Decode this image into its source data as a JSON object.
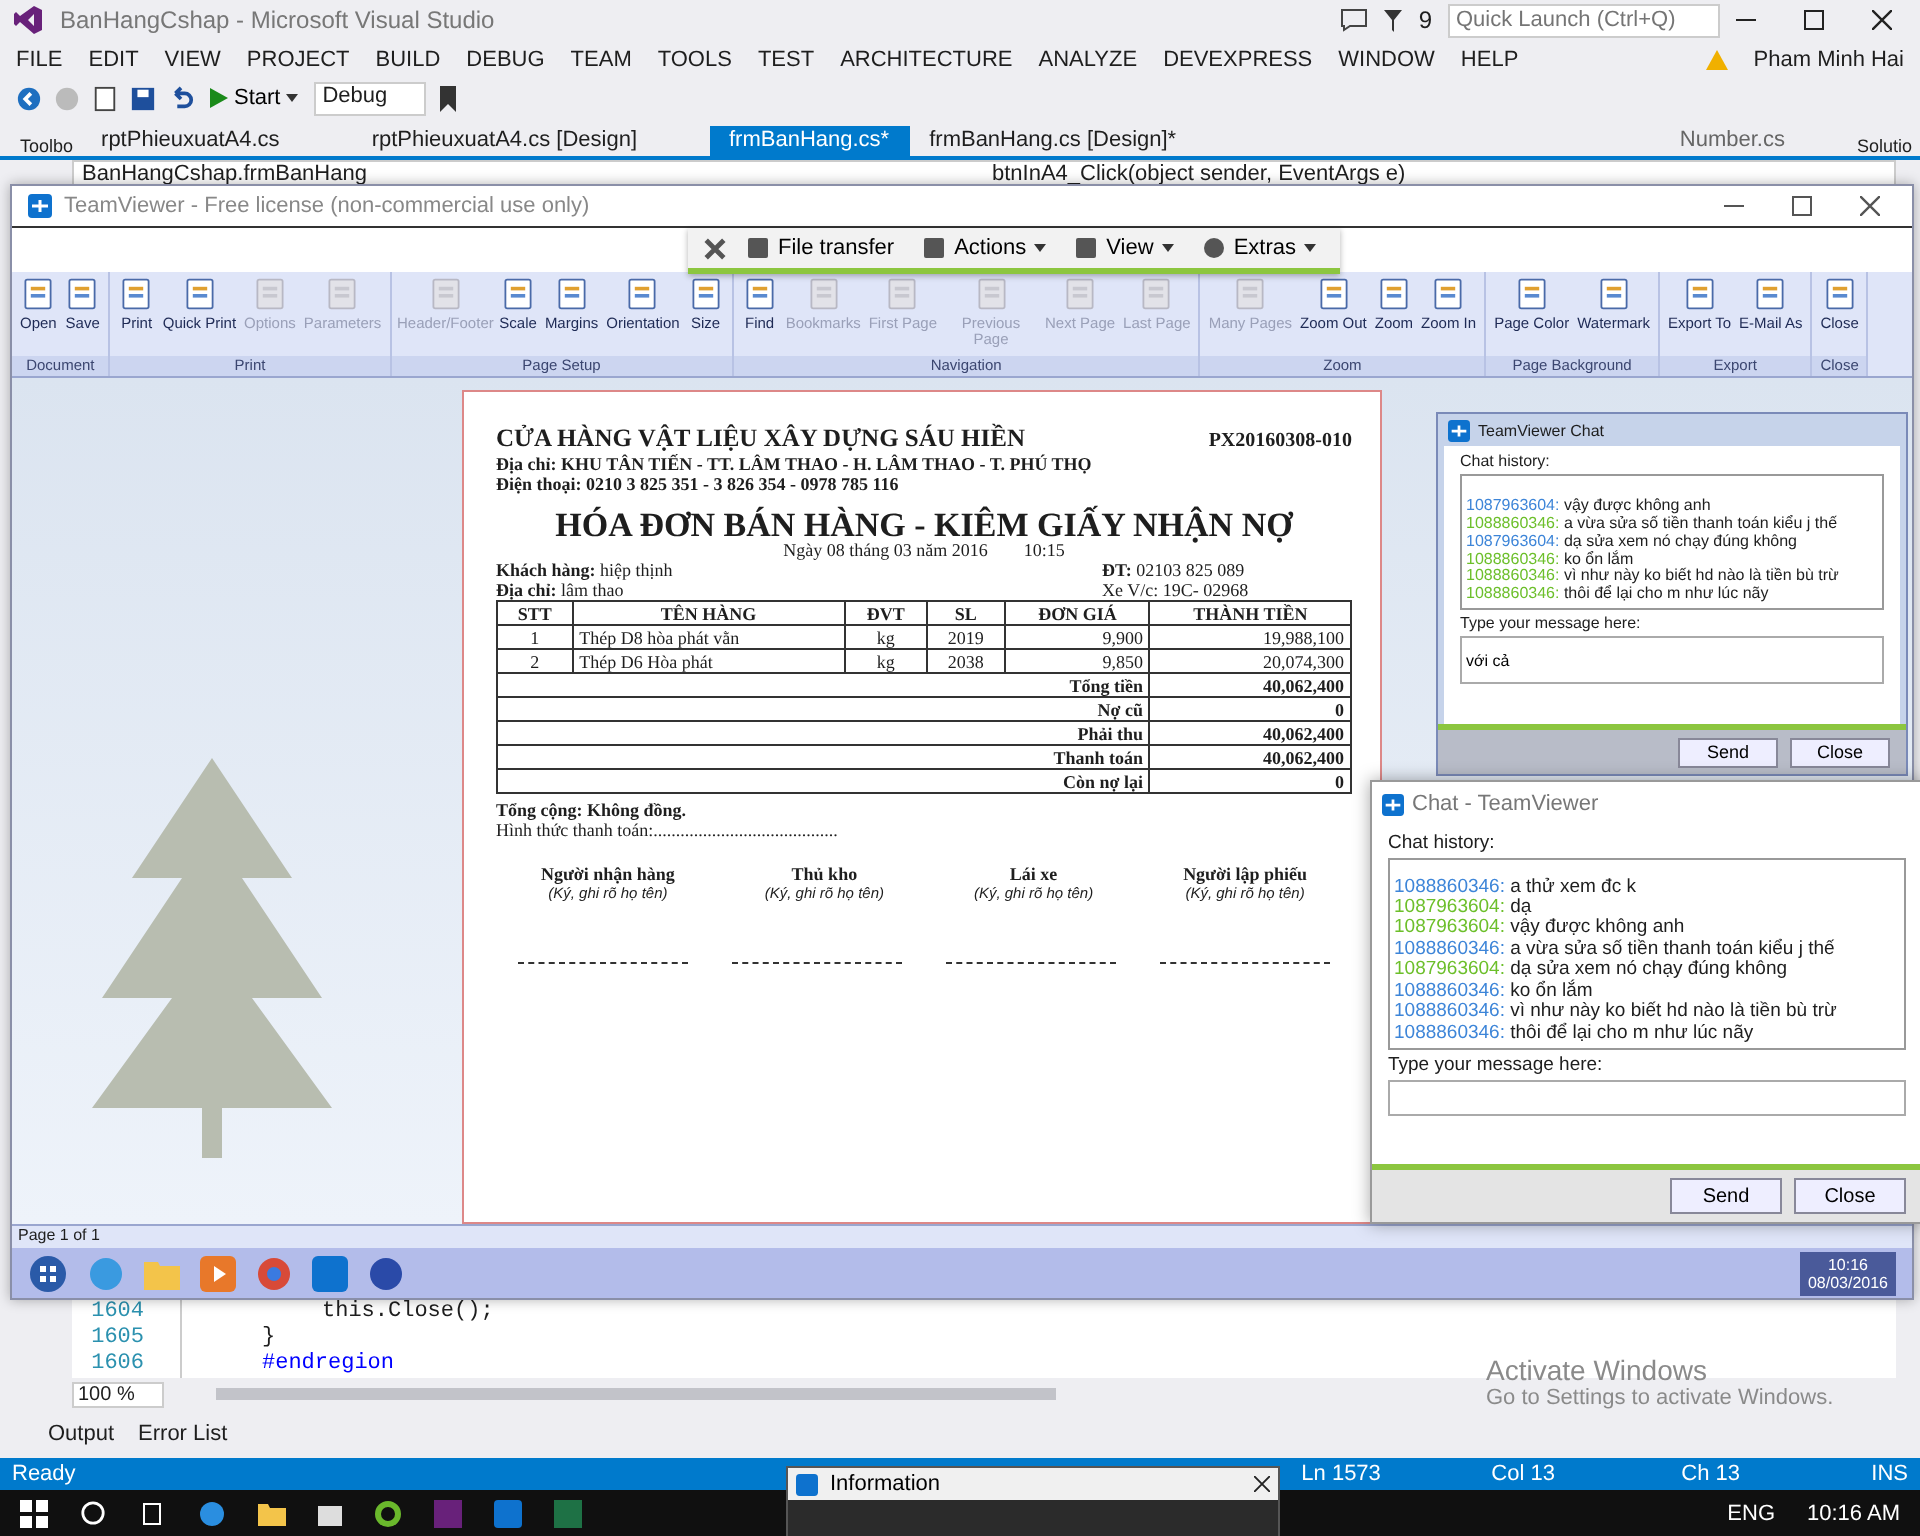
{
  "vs": {
    "title": "BanHangCshap - Microsoft Visual Studio",
    "notification_count": "9",
    "quick_launch": {
      "placeholder": "Quick Launch (Ctrl+Q)"
    },
    "menu": [
      "FILE",
      "EDIT",
      "VIEW",
      "PROJECT",
      "BUILD",
      "DEBUG",
      "TEAM",
      "TOOLS",
      "TEST",
      "ARCHITECTURE",
      "ANALYZE",
      "DEVEXPRESS",
      "WINDOW",
      "HELP"
    ],
    "user": "Pham Minh Hai",
    "toolbar": {
      "start": "Start",
      "config": "Debug"
    },
    "doc_tabs": [
      {
        "label": "rptPhieuxuatA4.cs",
        "selected": false
      },
      {
        "label": "rptPhieuxuatA4.cs [Design]",
        "selected": false
      },
      {
        "label": "frmBanHang.cs*",
        "selected": true
      },
      {
        "label": "frmBanHang.cs [Design]*",
        "selected": false
      }
    ],
    "pinned_tab": "Number.cs",
    "side_left": "Toolbo",
    "side_right": "Solutio",
    "nav": {
      "class": "BanHangCshap.frmBanHang",
      "member": "btnInA4_Click(object sender, EventArgs e)"
    },
    "code": [
      {
        "line": "1604",
        "text": "this.Close();",
        "kind": "statement"
      },
      {
        "line": "1605",
        "text": "}",
        "kind": "brace"
      },
      {
        "line": "1606",
        "text": "#endregion",
        "kind": "directive"
      }
    ],
    "zoom": "100 %",
    "bottom_tabs": [
      "Output",
      "Error List"
    ],
    "status": {
      "text": "Ready",
      "ln": "Ln 1573",
      "col": "Col 13",
      "ch": "Ch 13",
      "mode": "INS"
    },
    "activation": {
      "title": "Activate Windows",
      "text": "Go to Settings to activate Windows."
    },
    "popup": {
      "title": "Information"
    },
    "taskbar": {
      "lang": "ENG",
      "time": "10:16 AM"
    }
  },
  "teamviewer": {
    "title": "TeamViewer - Free license (non-commercial use only)",
    "panel": [
      "File transfer",
      "Actions",
      "View",
      "Extras"
    ],
    "ribbon": [
      {
        "group": "Document",
        "buttons": [
          {
            "label": "Open",
            "disabled": false
          },
          {
            "label": "Save",
            "disabled": false
          }
        ]
      },
      {
        "group": "Print",
        "buttons": [
          {
            "label": "Print",
            "disabled": false
          },
          {
            "label": "Quick Print",
            "disabled": false
          },
          {
            "label": "Options",
            "disabled": true
          },
          {
            "label": "Parameters",
            "disabled": true
          }
        ]
      },
      {
        "group": "Page Setup",
        "buttons": [
          {
            "label": "Header/Footer",
            "disabled": true
          },
          {
            "label": "Scale",
            "disabled": false
          },
          {
            "label": "Margins",
            "disabled": false
          },
          {
            "label": "Orientation",
            "disabled": false
          },
          {
            "label": "Size",
            "disabled": false
          }
        ]
      },
      {
        "group": "Navigation",
        "buttons": [
          {
            "label": "Find",
            "disabled": false
          },
          {
            "label": "Bookmarks",
            "disabled": true
          },
          {
            "label": "First Page",
            "disabled": true
          },
          {
            "label": "Previous Page",
            "disabled": true
          },
          {
            "label": "Next Page",
            "disabled": true
          },
          {
            "label": "Last Page",
            "disabled": true
          }
        ]
      },
      {
        "group": "Zoom",
        "buttons": [
          {
            "label": "Many Pages",
            "disabled": true
          },
          {
            "label": "Zoom Out",
            "disabled": false
          },
          {
            "label": "Zoom",
            "disabled": false
          },
          {
            "label": "Zoom In",
            "disabled": false
          }
        ]
      },
      {
        "group": "Page Background",
        "buttons": [
          {
            "label": "Page Color",
            "disabled": false
          },
          {
            "label": "Watermark",
            "disabled": false
          }
        ]
      },
      {
        "group": "Export",
        "buttons": [
          {
            "label": "Export To",
            "disabled": false
          },
          {
            "label": "E-Mail As",
            "disabled": false
          }
        ]
      },
      {
        "group": "Close",
        "buttons": [
          {
            "label": "Close",
            "disabled": false
          }
        ]
      }
    ],
    "invoice": {
      "shop": "CỬA HÀNG VẬT LIỆU XÂY DỰNG SÁU HIỀN",
      "code": "PX20160308-010",
      "address": "Địa chỉ: KHU TÂN TIẾN - TT. LÂM THAO - H. LÂM THAO - T. PHÚ THỌ",
      "phone": "Điện thoại: 0210 3 825 351 - 3 826 354 - 0978 785 116",
      "title": "HÓA ĐƠN BÁN HÀNG - KIÊM GIẤY NHẬN NỢ",
      "date": "Ngày 08  tháng 03  năm 2016",
      "time": "10:15",
      "customer_label": "Khách hàng:",
      "customer": "hiệp thịnh",
      "phone_label": "ĐT:",
      "customer_phone": "02103 825 089",
      "address_label": "Địa chỉ:",
      "customer_address": "lâm thao",
      "vehicle": "Xe V/c: 19C- 02968",
      "columns": [
        "STT",
        "TÊN HÀNG",
        "ĐVT",
        "SL",
        "ĐƠN GIÁ",
        "THÀNH TIỀN"
      ],
      "rows": [
        [
          "1",
          "Thép D8 hòa phát vằn",
          "kg",
          "2019",
          "9,900",
          "19,988,100"
        ],
        [
          "2",
          "Thép D6 Hòa phát",
          "kg",
          "2038",
          "9,850",
          "20,074,300"
        ]
      ],
      "totals": [
        {
          "label": "Tổng tiền",
          "value": "40,062,400"
        },
        {
          "label": "Nợ cũ",
          "value": "0"
        },
        {
          "label": "Phải thu",
          "value": "40,062,400"
        },
        {
          "label": "Thanh toán",
          "value": "40,062,400"
        },
        {
          "label": "Còn nợ lại",
          "value": "0"
        }
      ],
      "total_words": "Tổng cộng: Không đồng.",
      "payment": "Hình thức thanh toán:.........................................",
      "signatures": [
        {
          "role": "Người nhận  hàng",
          "note": "(Ký, ghi rõ họ tên)"
        },
        {
          "role": "Thủ kho",
          "note": "(Ký, ghi rõ họ tên)"
        },
        {
          "role": "Lái xe",
          "note": "(Ký, ghi rõ họ tên)"
        },
        {
          "role": "Người lập phiếu",
          "note": "(Ký, ghi rõ họ tên)"
        }
      ]
    },
    "page_status": "Page 1 of 1",
    "remote_clock": {
      "time": "10:16",
      "date": "08/03/2016"
    },
    "remote_chat": {
      "title": "TeamViewer Chat",
      "history_label": "Chat history:",
      "messages": [
        {
          "sender": "1087963604:",
          "text": "vậy được không anh",
          "color": "#3d85d8"
        },
        {
          "sender": "1088860346:",
          "text": "a vừa sửa số tiền thanh toán kiểu j thế",
          "color": "#6cbf2a"
        },
        {
          "sender": "1087963604:",
          "text": "dạ sửa xem nó chạy đúng không",
          "color": "#3d85d8"
        },
        {
          "sender": "1088860346:",
          "text": "ko ổn lắm",
          "color": "#6cbf2a"
        },
        {
          "sender": "1088860346:",
          "text": "vì như này ko biết hd nào là tiền bù trừ",
          "color": "#6cbf2a"
        },
        {
          "sender": "1088860346:",
          "text": "thôi để lại cho m như lúc nãy",
          "color": "#6cbf2a"
        }
      ],
      "input_label": "Type your message here:",
      "input_value": "với cả",
      "send": "Send",
      "close": "Close"
    }
  },
  "chat": {
    "title": "Chat - TeamViewer",
    "history_label": "Chat history:",
    "messages": [
      {
        "sender": "1088860346:",
        "text": "a thử xem đc k",
        "color": "#3d85d8"
      },
      {
        "sender": "1087963604:",
        "text": "dạ",
        "color": "#6cbf2a"
      },
      {
        "sender": "1087963604:",
        "text": "vậy được không anh",
        "color": "#6cbf2a"
      },
      {
        "sender": "1088860346:",
        "text": "a vừa sửa số tiền thanh toán kiểu j thế",
        "color": "#3d85d8"
      },
      {
        "sender": "1087963604:",
        "text": "dạ sửa xem nó chạy đúng không",
        "color": "#6cbf2a"
      },
      {
        "sender": "1088860346:",
        "text": "ko ổn lắm",
        "color": "#3d85d8"
      },
      {
        "sender": "1088860346:",
        "text": "vì như này ko biết hd nào là tiền bù trừ",
        "color": "#3d85d8"
      },
      {
        "sender": "1088860346:",
        "text": "thôi để lại cho m như lúc nãy",
        "color": "#3d85d8"
      }
    ],
    "input_label": "Type your message here:",
    "send": "Send",
    "close": "Close"
  }
}
